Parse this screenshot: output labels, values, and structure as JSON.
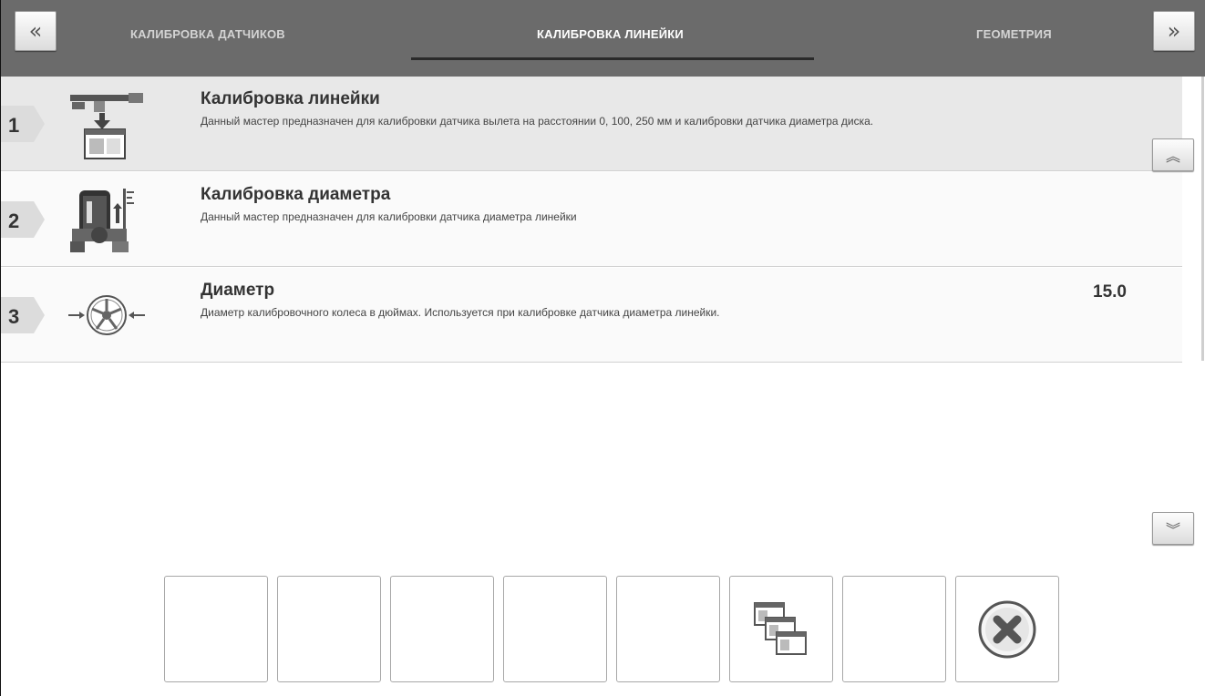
{
  "header": {
    "prev_icon": "double-chevron-left-icon",
    "next_icon": "double-chevron-right-icon",
    "tabs": [
      {
        "label": "КАЛИБРОВКА ДАТЧИКОВ"
      },
      {
        "label": "КАЛИБРОВКА ЛИНЕЙКИ"
      },
      {
        "label": "ГЕОМЕТРИЯ"
      }
    ]
  },
  "list": {
    "items": [
      {
        "number": "1",
        "icon": "ruler-calibration-icon",
        "title": "Калибровка линейки",
        "description": "Данный мастер предназначен для калибровки датчика вылета на расстоянии 0, 100, 250 мм и калибровки датчика диаметра диска."
      },
      {
        "number": "2",
        "icon": "diameter-calibration-icon",
        "title": "Калибровка диаметра",
        "description": "Данный мастер предназначен для калибровки датчика диаметра линейки"
      },
      {
        "number": "3",
        "icon": "wheel-diameter-icon",
        "title": "Диаметр",
        "description": "Диаметр калибровочного колеса в дюймах. Используется при калибровке датчика диаметра линейки.",
        "value": "15.0"
      }
    ]
  },
  "scroll": {
    "up_icon": "scroll-up-icon",
    "down_icon": "scroll-down-icon"
  },
  "toolbar": {
    "buttons": [
      {
        "icon": ""
      },
      {
        "icon": ""
      },
      {
        "icon": ""
      },
      {
        "icon": ""
      },
      {
        "icon": ""
      },
      {
        "icon": "windows-stack-icon"
      },
      {
        "icon": ""
      },
      {
        "icon": "close-x-icon"
      }
    ]
  },
  "colors": {
    "header_bg": "#6b6b6b",
    "active_tab": "#ffffff",
    "inactive_tab": "#d4d4d4",
    "selected_row": "#e8e8e8"
  }
}
